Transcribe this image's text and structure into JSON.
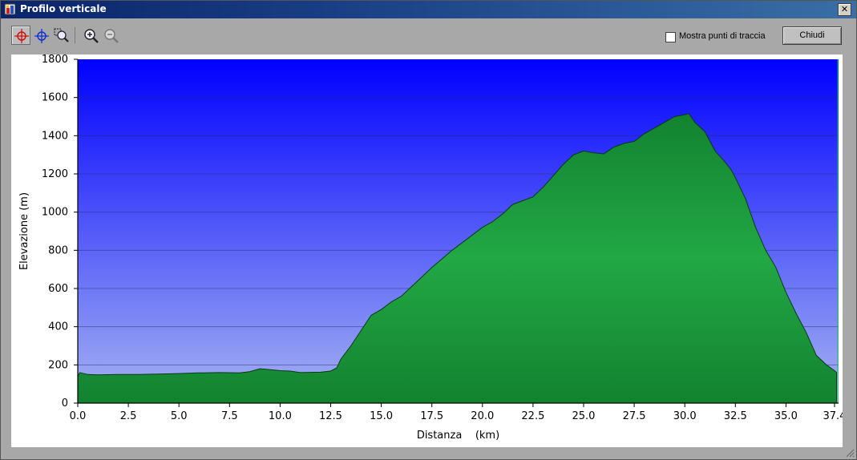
{
  "window": {
    "title": "Profilo verticale",
    "close_glyph": "✕"
  },
  "toolbar": {
    "tools": [
      {
        "name": "crosshair-red-icon",
        "active": true
      },
      {
        "name": "crosshair-blue-icon",
        "active": false
      },
      {
        "name": "zoom-area-icon",
        "active": false
      },
      {
        "name": "zoom-in-icon",
        "active": false
      },
      {
        "name": "zoom-out-icon",
        "active": false
      }
    ],
    "show_points_label": "Mostra punti di traccia",
    "show_points_checked": false,
    "close_button_label": "Chiudi"
  },
  "chart_data": {
    "type": "area",
    "xlabel": "Distanza    (km)",
    "ylabel": "Elevazione (m)",
    "xlim": [
      0,
      37.6
    ],
    "ylim": [
      0,
      1800
    ],
    "x_ticks": [
      "0.0",
      "2.5",
      "5.0",
      "7.5",
      "10.0",
      "12.5",
      "15.0",
      "17.5",
      "20.0",
      "22.5",
      "25.0",
      "27.5",
      "30.0",
      "32.5",
      "35.0",
      "37.4"
    ],
    "x_tick_values": [
      0,
      2.5,
      5,
      7.5,
      10,
      12.5,
      15,
      17.5,
      20,
      22.5,
      25,
      27.5,
      30,
      32.5,
      35,
      37.4
    ],
    "y_ticks": [
      0,
      200,
      400,
      600,
      800,
      1000,
      1200,
      1400,
      1600,
      1800
    ],
    "grid": true,
    "colors": {
      "sky_top": "#0000ff",
      "sky_bottom": "#a6b4f2",
      "fill": "#1f9a3d",
      "fill_dark": "#138230",
      "outline": "#0b3a14"
    },
    "series": [
      {
        "x": [
          0,
          0.1,
          0.5,
          1,
          2,
          3,
          4,
          5,
          6,
          7,
          8,
          8.5,
          9,
          9.5,
          10,
          10.5,
          11,
          12,
          12.5,
          12.8,
          13,
          13.5,
          14,
          14.5,
          15,
          15.5,
          16,
          16.5,
          17,
          17.5,
          18,
          18.5,
          19,
          19.5,
          20,
          20.5,
          21,
          21.5,
          22,
          22.5,
          23,
          23.5,
          24,
          24.5,
          25,
          25.5,
          26,
          26.5,
          27,
          27.5,
          28,
          28.5,
          29,
          29.5,
          30,
          30.2,
          30.5,
          31,
          31.5,
          32,
          32.3,
          32.5,
          33,
          33.5,
          34,
          34.5,
          35,
          35.5,
          36,
          36.5,
          37,
          37.4,
          37.5
        ],
        "y": [
          140,
          160,
          150,
          148,
          150,
          150,
          152,
          155,
          158,
          160,
          158,
          165,
          180,
          175,
          170,
          168,
          160,
          162,
          168,
          185,
          230,
          300,
          380,
          460,
          490,
          530,
          560,
          610,
          660,
          710,
          755,
          800,
          840,
          880,
          920,
          950,
          990,
          1040,
          1060,
          1080,
          1130,
          1190,
          1250,
          1300,
          1320,
          1310,
          1305,
          1340,
          1360,
          1370,
          1410,
          1440,
          1470,
          1500,
          1510,
          1515,
          1470,
          1420,
          1320,
          1260,
          1220,
          1180,
          1070,
          920,
          800,
          710,
          580,
          470,
          370,
          250,
          200,
          170,
          160
        ]
      }
    ]
  }
}
